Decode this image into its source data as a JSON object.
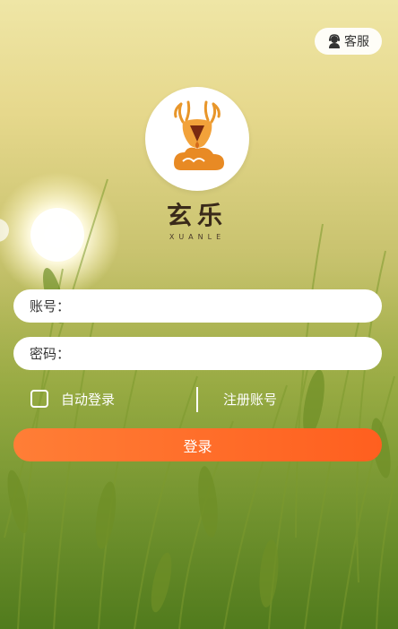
{
  "customer_service": {
    "icon": "agent-icon",
    "label": "客服"
  },
  "brand": {
    "logo_icon": "deer-logo-icon",
    "name": "玄乐",
    "subtitle": "XUANLE"
  },
  "form": {
    "account_label": "账号：",
    "account_value": "",
    "password_label": "密码：",
    "password_value": ""
  },
  "options": {
    "auto_login_label": "自动登录",
    "auto_login_checked": false,
    "register_label": "注册账号"
  },
  "login_button": {
    "label": "登录"
  },
  "colors": {
    "accent": "#ff6a28",
    "field_bg": "#ffffff",
    "logo_orange": "#e8962a"
  }
}
